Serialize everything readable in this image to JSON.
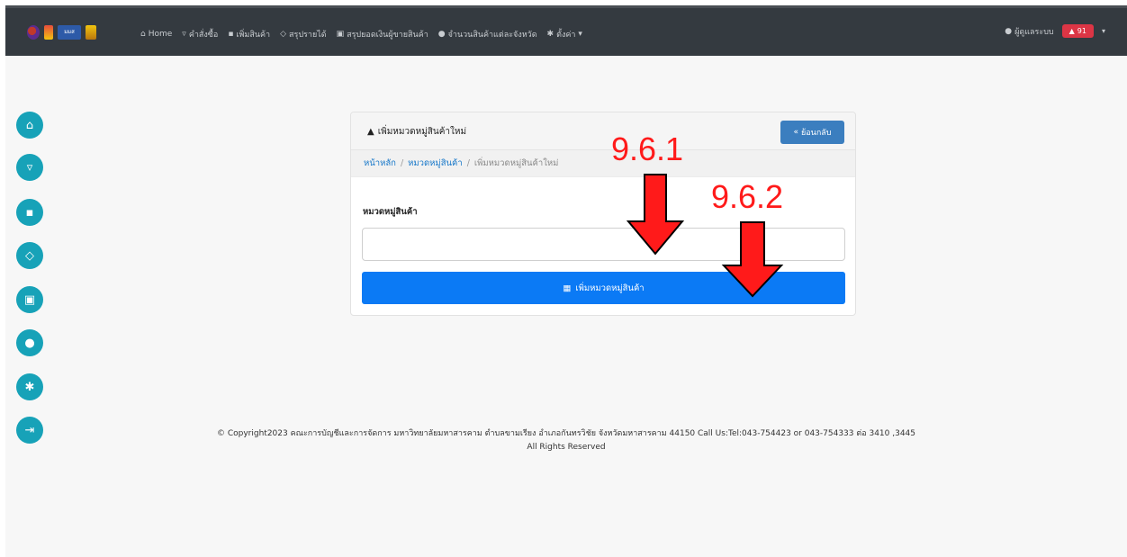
{
  "navbar": {
    "logo_text": "มมส",
    "items": [
      {
        "icon": "home-icon",
        "glyph": "⌂",
        "label": "Home"
      },
      {
        "icon": "cart-icon",
        "glyph": "▿",
        "label": "คำสั่งซื้อ"
      },
      {
        "icon": "bag-icon",
        "glyph": "▪",
        "label": "เพิ่มสินค้า"
      },
      {
        "icon": "gem-icon",
        "glyph": "◇",
        "label": "สรุปรายได้"
      },
      {
        "icon": "money-icon",
        "glyph": "▣",
        "label": "สรุปยอดเงินผู้ขายสินค้า"
      },
      {
        "icon": "location-icon",
        "glyph": "●",
        "label": "จำนวนสินค้าแต่ละจังหวัด"
      },
      {
        "icon": "gear-icon",
        "glyph": "✱",
        "label": "ตั้งค่า"
      }
    ],
    "settings_caret": "▾",
    "user_label": "ผู้ดูแลระบบ",
    "bell_count": "91",
    "user_caret": "▾"
  },
  "sidebar": {
    "buttons": [
      {
        "name": "sidebar-home-button",
        "icon": "home-icon",
        "glyph": "⌂"
      },
      {
        "name": "sidebar-cart-button",
        "icon": "cart-icon",
        "glyph": "▿"
      },
      {
        "name": "sidebar-bag-button",
        "icon": "bag-icon",
        "glyph": "▪"
      },
      {
        "name": "sidebar-gem-button",
        "icon": "gem-icon",
        "glyph": "◇"
      },
      {
        "name": "sidebar-money-button",
        "icon": "money-icon",
        "glyph": "▣"
      },
      {
        "name": "sidebar-location-button",
        "icon": "location-icon",
        "glyph": "●"
      },
      {
        "name": "sidebar-settings-button",
        "icon": "gear-icon",
        "glyph": "✱"
      },
      {
        "name": "sidebar-logout-button",
        "icon": "logout-icon",
        "glyph": "⇥"
      }
    ]
  },
  "card": {
    "title": "เพิ่มหมวดหมู่สินค้าใหม่",
    "title_icon": "sitemap-icon",
    "back_label": "ย้อนกลับ",
    "back_glyph": "«",
    "breadcrumb": {
      "home": "หน้าหลัก",
      "separator": "/",
      "category": "หมวดหมู่สินค้า",
      "current": "เพิ่มหมวดหมู่สินค้าใหม่"
    },
    "field_label": "หมวดหมู่สินค้า",
    "field_value": "",
    "field_placeholder": "",
    "submit_label": "เพิ่มหมวดหมู่สินค้า",
    "submit_icon": "save-icon"
  },
  "footer": {
    "line1": "© Copyright2023 คณะการบัญชีและการจัดการ มหาวิทยาลัยมหาสารคาม ตำบลขามเรียง อำเภอกันทรวิชัย จังหวัดมหาสารคาม 44150 Call Us:Tel:043-754423 or 043-754333 ต่อ 3410 ,3445",
    "line2": "All Rights Reserved"
  },
  "annotations": {
    "label1": "9.6.1",
    "label2": "9.6.2",
    "color": "#ff1a1a"
  },
  "colors": {
    "navbar": "#343a40",
    "sidebar_button": "#17a2b8",
    "back_button": "#3b7ebf",
    "submit_button": "#0b7af5",
    "link": "#1677c9",
    "bell_button": "#dc3545"
  }
}
